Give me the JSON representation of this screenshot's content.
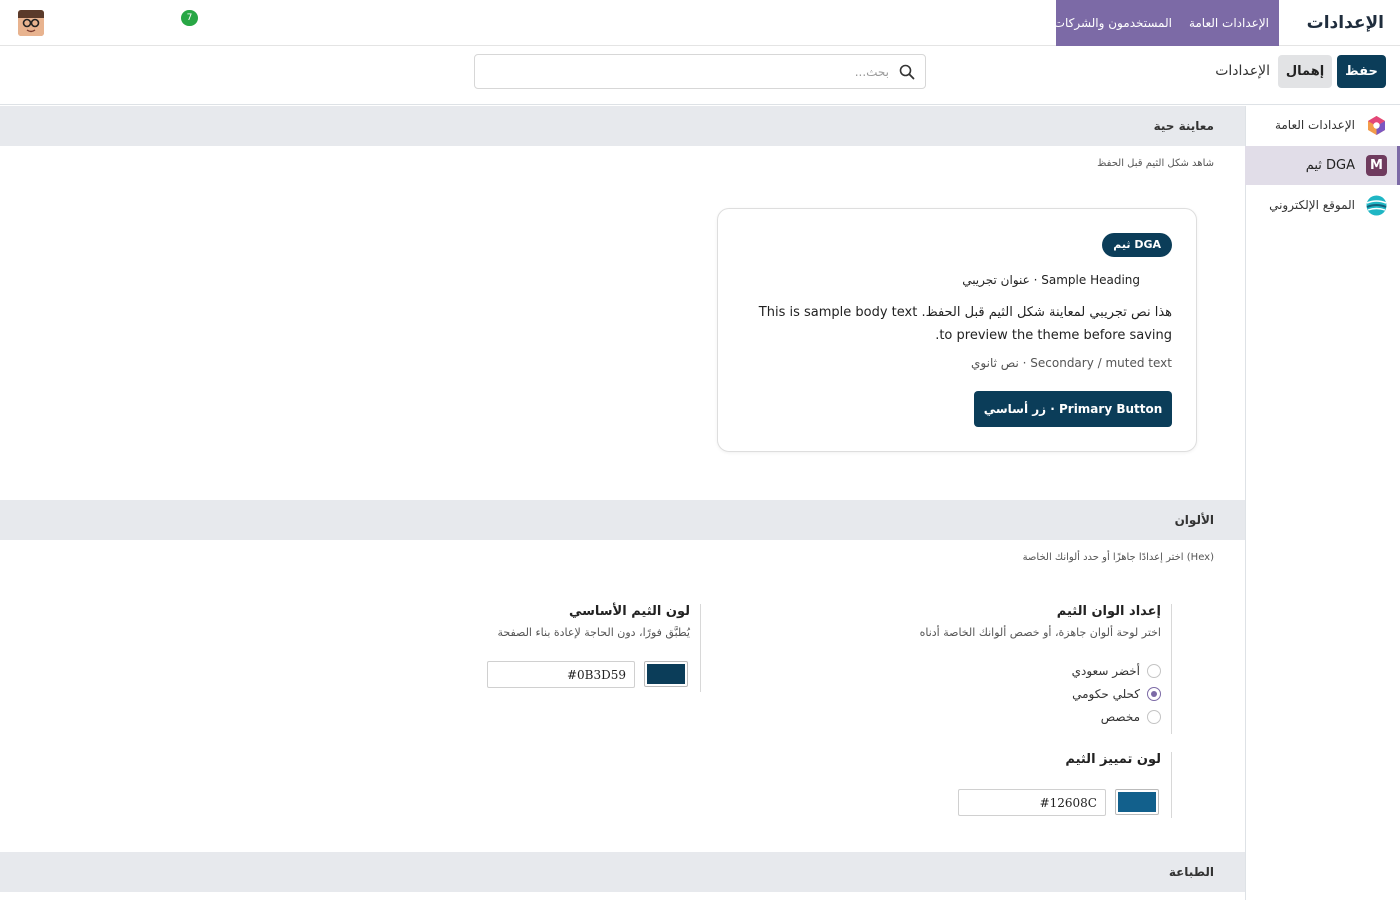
{
  "navbar": {
    "brand": "الإعدادات",
    "menu": [
      "الإعدادات العامة",
      "المستخدمون والشركات"
    ],
    "badge_count": "7"
  },
  "control": {
    "save_label": "حفظ",
    "discard_label": "إهمال",
    "breadcrumb": "الإعدادات",
    "search_placeholder": "بحث..."
  },
  "sidebar": {
    "items": [
      {
        "label": "الإعدادات العامة",
        "icon": "settings-app-icon",
        "color": "#f39c4a"
      },
      {
        "label": "ثيم DGA",
        "icon": "theme-m-icon",
        "color": "#6f3b5e",
        "letter": "M"
      },
      {
        "label": "الموقع الإلكتروني",
        "icon": "website-icon",
        "color": "#1fb6c4"
      }
    ]
  },
  "preview": {
    "section_title": "معاينة حية",
    "section_desc": "شاهد شكل الثيم قبل الحفظ",
    "badge": "ثيم DGA",
    "heading": "عنوان تجريبي · Sample Heading",
    "body": "هذا نص تجريبي لمعاينة شكل الثيم قبل الحفظ. This is sample body text to preview the theme before saving.",
    "muted": "نص ثانوي · Secondary / muted text",
    "button": "زر أساسي · Primary Button"
  },
  "colors": {
    "section_title": "الألوان",
    "section_desc": "اختر إعدادًا جاهزًا أو حدد ألوانك الخاصة (Hex)",
    "preset": {
      "title": "إعداد الوان الثيم",
      "desc": "اختر لوحة ألوان جاهزة، أو خصص ألوانك الخاصة أدناه",
      "options": [
        {
          "label": "أخضر سعودي",
          "checked": false
        },
        {
          "label": "كحلي حكومي",
          "checked": true
        },
        {
          "label": "مخصص",
          "checked": false
        }
      ]
    },
    "primary": {
      "title": "لون الثيم الأساسي",
      "desc": "يُطبَّق فورًا، دون الحاجة لإعادة بناء الصفحة",
      "value": "#0B3D59"
    },
    "accent": {
      "title": "لون تمييز الثيم",
      "value": "#12608C"
    }
  },
  "typography": {
    "section_title": "الطباعة"
  },
  "theme_colors": {
    "primary": "#0b3d59",
    "accent": "#12608c",
    "menu": "#7c6aa6"
  }
}
